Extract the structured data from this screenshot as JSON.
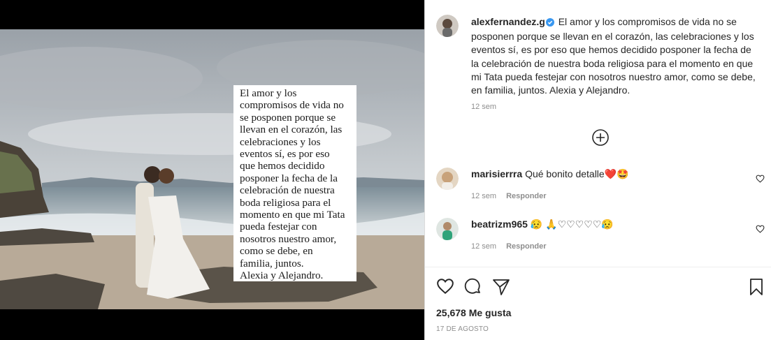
{
  "post": {
    "author": "alexfernandez.g",
    "caption": "El amor y los compromisos de vida no se posponen porque se llevan en el corazón, las celebraciones y los eventos sí, es por eso que hemos decidido posponer la fecha de la celebración de nuestra boda religiosa para el momento en que mi Tata pueda festejar con nosotros nuestro amor, como se debe, en familia, juntos. Alexia y Alejandro.",
    "caption_time": "12 sem",
    "likes": "25,678 Me gusta",
    "date": "17 DE AGOSTO"
  },
  "image_text": [
    "El amor y los",
    "compromisos de vida no",
    "se posponen porque se",
    "llevan en el corazón, las",
    "celebraciones y los",
    "eventos sí, es por eso",
    "que hemos decidido",
    "posponer la fecha de la",
    "celebración de nuestra",
    "boda religiosa para el",
    "momento en que mi Tata",
    "pueda festejar con",
    "nosotros  nuestro amor,",
    "como se debe, en",
    "familia, juntos.",
    "Alexia y Alejandro."
  ],
  "comments": [
    {
      "user": "marisierrra",
      "text": "Qué bonito detalle",
      "emojis": "❤️🤩",
      "time": "12 sem",
      "reply_label": "Responder"
    },
    {
      "user": "beatrizm965",
      "text": "",
      "emojis": "😥 🙏♡♡♡♡♡😥",
      "time": "12 sem",
      "reply_label": "Responder"
    }
  ],
  "colors": {
    "verified_blue": "#3897f0",
    "muted_gray": "#8e8e8e",
    "text": "#262626"
  },
  "icons": [
    "verified-icon",
    "load-more-icon",
    "like-icon",
    "comment-icon",
    "share-icon",
    "save-icon"
  ]
}
